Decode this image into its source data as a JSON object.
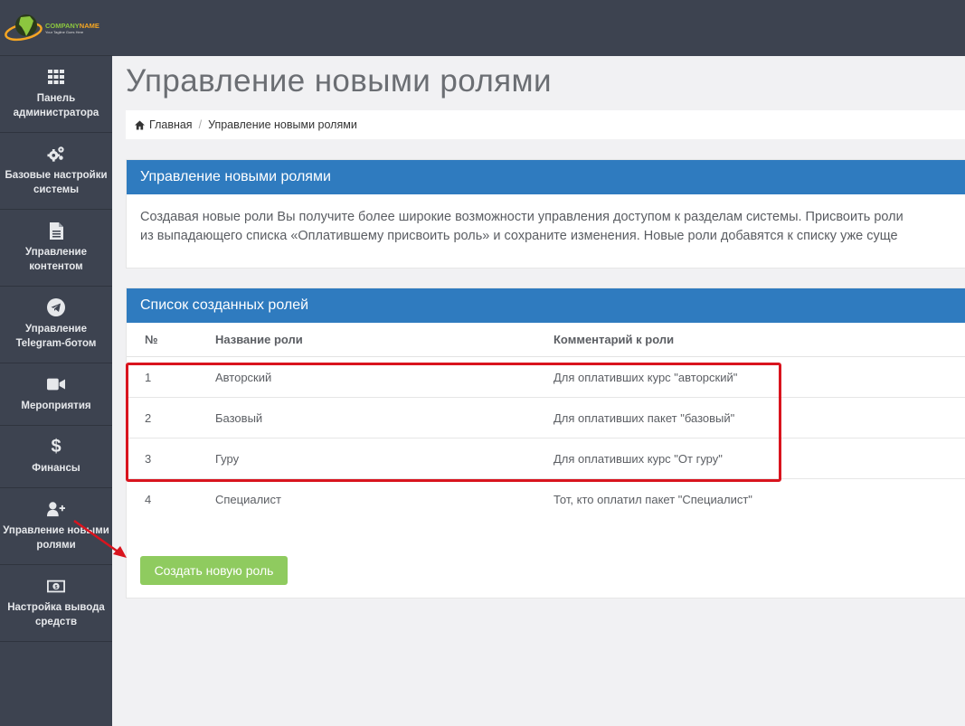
{
  "brand": {
    "name_part1": "COMPANY",
    "name_part2": "NAME",
    "tagline": "Your Tagline Goes Here"
  },
  "sidebar": {
    "items": [
      {
        "label": "Панель администратора",
        "icon": "grid-icon"
      },
      {
        "label": "Базовые настройки системы",
        "icon": "gears-icon"
      },
      {
        "label": "Управление контентом",
        "icon": "file-icon"
      },
      {
        "label": "Управление Telegram-ботом",
        "icon": "telegram-icon"
      },
      {
        "label": "Мероприятия",
        "icon": "video-camera-icon"
      },
      {
        "label": "Финансы",
        "icon": "dollar-icon"
      },
      {
        "label": "Управление новыми ролями",
        "icon": "user-plus-icon"
      },
      {
        "label": "Настройка вывода средств",
        "icon": "money-icon"
      }
    ]
  },
  "page": {
    "title": "Управление новыми ролями"
  },
  "breadcrumb": {
    "home": "Главная",
    "separator": "/",
    "current": "Управление новыми ролями"
  },
  "info_panel": {
    "title": "Управление новыми ролями",
    "line1": "Создавая новые роли Вы получите более широкие возможности управления доступом к разделам системы. Присвоить роли",
    "line2": "из выпадающего списка «Оплатившему присвоить роль» и сохраните изменения. Новые роли добавятся к списку уже суще"
  },
  "roles_panel": {
    "title": "Список созданных ролей",
    "columns": [
      "№",
      "Название роли",
      "Комментарий к роли"
    ],
    "rows": [
      {
        "num": "1",
        "name": "Авторский",
        "comment": "Для оплативших курс \"авторский\""
      },
      {
        "num": "2",
        "name": "Базовый",
        "comment": "Для оплативших пакет \"базовый\""
      },
      {
        "num": "3",
        "name": "Гуру",
        "comment": "Для оплативших курс \"От гуру\""
      },
      {
        "num": "4",
        "name": "Специалист",
        "comment": "Тот, кто оплатил пакет \"Специалист\""
      }
    ],
    "create_button": "Создать новую роль"
  },
  "colors": {
    "sidebar_bg": "#3d4350",
    "panel_header": "#2f7bbf",
    "button_green": "#8fcb5f",
    "annotation_red": "#d9141e"
  }
}
